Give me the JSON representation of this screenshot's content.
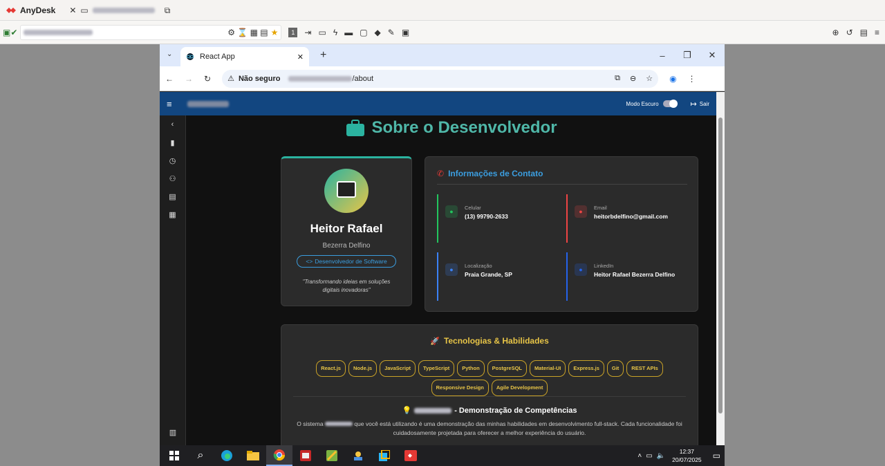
{
  "anydesk": {
    "app_name": "AnyDesk",
    "session_tab": "",
    "address": ""
  },
  "browser": {
    "tab_title": "React App",
    "url_warning": "Não seguro",
    "url_path": "/about"
  },
  "app": {
    "header": {
      "title": "",
      "dark_mode_label": "Modo Escuro",
      "logout_label": "Sair"
    },
    "page_title": "Sobre o Desenvolvedor",
    "profile": {
      "first_name": "Heitor Rafael",
      "last_name": "Bezerra Delfino",
      "role": "Desenvolvedor de Software",
      "quote": "\"Transformando ideias em soluções digitais inovadoras\""
    },
    "contact": {
      "title": "Informações de Contato",
      "items": [
        {
          "label": "Celular",
          "value": "(13) 99790-2633",
          "color": "#22c55e"
        },
        {
          "label": "Email",
          "value": "heitorbdelfino@gmail.com",
          "color": "#ef4444"
        },
        {
          "label": "Localização",
          "value": "Praia Grande, SP",
          "color": "#3b82f6"
        },
        {
          "label": "LinkedIn",
          "value": "Heitor Rafael Bezerra Delfino",
          "color": "#2563eb"
        }
      ]
    },
    "skills": {
      "title": "Tecnologias & Habilidades",
      "chips": [
        "React.js",
        "Node.js",
        "JavaScript",
        "TypeScript",
        "Python",
        "PostgreSQL",
        "Material-UI",
        "Express.js",
        "Git",
        "REST APIs",
        "Responsive Design",
        "Agile Development"
      ]
    },
    "demo": {
      "title": "- Demonstração de Competências",
      "text_pre": "O sistema",
      "text_post": "que você está utilizando é uma demonstração das minhas habilidades em desenvolvimento full-stack. Cada funcionalidade foi cuidadosamente projetada para oferecer a melhor experiência do usuário."
    }
  },
  "taskbar": {
    "time": "12:37",
    "date": "20/07/2025"
  }
}
